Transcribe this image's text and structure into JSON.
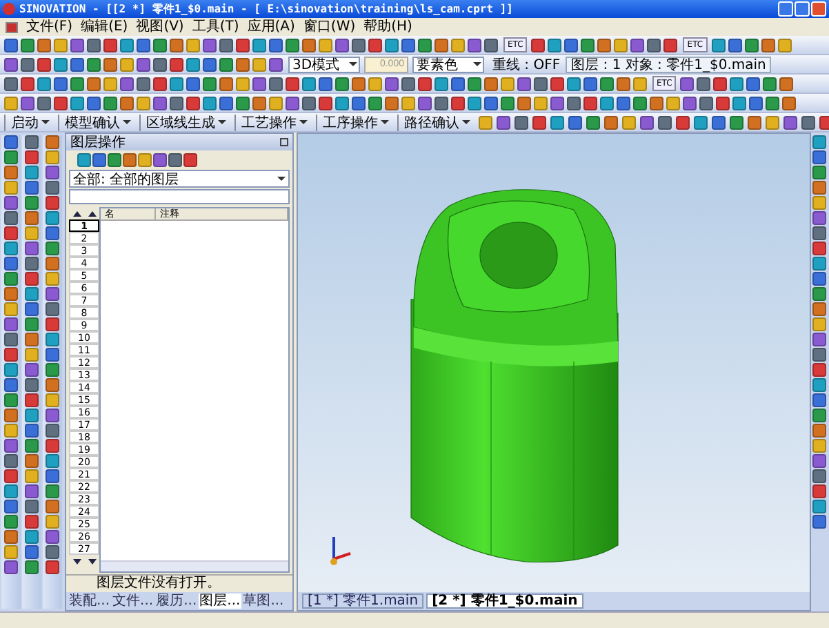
{
  "window": {
    "title": "SINOVATION - [[2 *] 零件1_$0.main - [ E:\\sinovation\\training\\ls_cam.cprt ]]"
  },
  "menu": [
    "文件(F)",
    "编辑(E)",
    "视图(V)",
    "工具(T)",
    "应用(A)",
    "窗口(W)",
    "帮助(H)"
  ],
  "toolbar_1": {
    "items": [
      {
        "kind": "etc",
        "label": "ETC"
      },
      {
        "kind": "etc",
        "label": "ETC"
      }
    ]
  },
  "toolbar_2": {
    "items": [
      {
        "kind": "combo",
        "label": "3D模式"
      },
      {
        "kind": "field",
        "value": "0.000"
      },
      {
        "kind": "combo",
        "label": "要素色"
      },
      {
        "kind": "label",
        "label": "重线 : OFF"
      },
      {
        "kind": "info",
        "label": "图层 : 1  对象 : 零件1_$0.main"
      }
    ]
  },
  "toolbar_3": {
    "items": [
      {
        "kind": "etc",
        "label": "ETC"
      }
    ]
  },
  "process_menu": [
    "启动",
    "模型确认",
    "区域线生成",
    "工艺操作",
    "工序操作",
    "路径确认"
  ],
  "layer_panel": {
    "title": "图层操作",
    "filter": "全部: 全部的图层",
    "columns": [
      "名",
      "注释"
    ],
    "rows": [
      {
        "number": "1",
        "selected": true
      },
      {
        "number": "2",
        "selected": false
      },
      {
        "number": "3",
        "selected": false
      },
      {
        "number": "4",
        "selected": false
      },
      {
        "number": "5",
        "selected": false
      },
      {
        "number": "6",
        "selected": false
      },
      {
        "number": "7",
        "selected": false
      },
      {
        "number": "8",
        "selected": false
      },
      {
        "number": "9",
        "selected": false
      },
      {
        "number": "10",
        "selected": false
      },
      {
        "number": "11",
        "selected": false
      },
      {
        "number": "12",
        "selected": false
      },
      {
        "number": "13",
        "selected": false
      },
      {
        "number": "14",
        "selected": false
      },
      {
        "number": "15",
        "selected": false
      },
      {
        "number": "16",
        "selected": false
      },
      {
        "number": "17",
        "selected": false
      },
      {
        "number": "18",
        "selected": false
      },
      {
        "number": "19",
        "selected": false
      },
      {
        "number": "20",
        "selected": false
      },
      {
        "number": "21",
        "selected": false
      },
      {
        "number": "22",
        "selected": false
      },
      {
        "number": "23",
        "selected": false
      },
      {
        "number": "24",
        "selected": false
      },
      {
        "number": "25",
        "selected": false
      },
      {
        "number": "26",
        "selected": false
      },
      {
        "number": "27",
        "selected": false
      }
    ],
    "status": "图层文件没有打开。",
    "tabs": [
      {
        "label": "装配...",
        "selected": false
      },
      {
        "label": "文件...",
        "selected": false
      },
      {
        "label": "履历...",
        "selected": false
      },
      {
        "label": "图层...",
        "selected": true
      },
      {
        "label": "草图...",
        "selected": false
      }
    ]
  },
  "document_tabs": [
    {
      "label": "[1 *] 零件1.main",
      "selected": false
    },
    {
      "label": "[2 *] 零件1_$0.main",
      "selected": true
    }
  ]
}
